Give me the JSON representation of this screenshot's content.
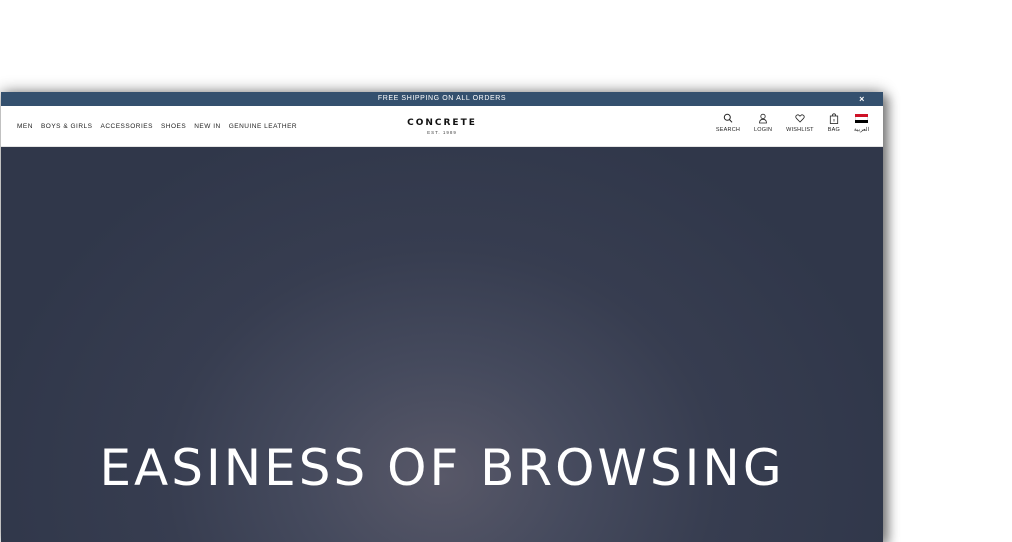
{
  "promo": {
    "text": "FREE SHIPPING ON ALL ORDERS",
    "close": "×"
  },
  "nav": {
    "links": [
      "MEN",
      "BOYS & GIRLS",
      "ACCESSORIES",
      "SHOES",
      "NEW IN",
      "GENUINE LEATHER"
    ]
  },
  "brand": {
    "name": "CONCRETE",
    "est": "EST. 1989"
  },
  "actions": {
    "search": "SEARCH",
    "login": "LOGIN",
    "wishlist": "WISHLIST",
    "bag": "BAG",
    "bag_count": "0",
    "language": "العربية"
  },
  "hero": {
    "title": "EASINESS OF BROWSING"
  },
  "colors": {
    "promo_bar": "#34506e",
    "hero_bg": "#30374a",
    "flag": [
      "#ce1126",
      "#ffffff",
      "#000000"
    ]
  }
}
